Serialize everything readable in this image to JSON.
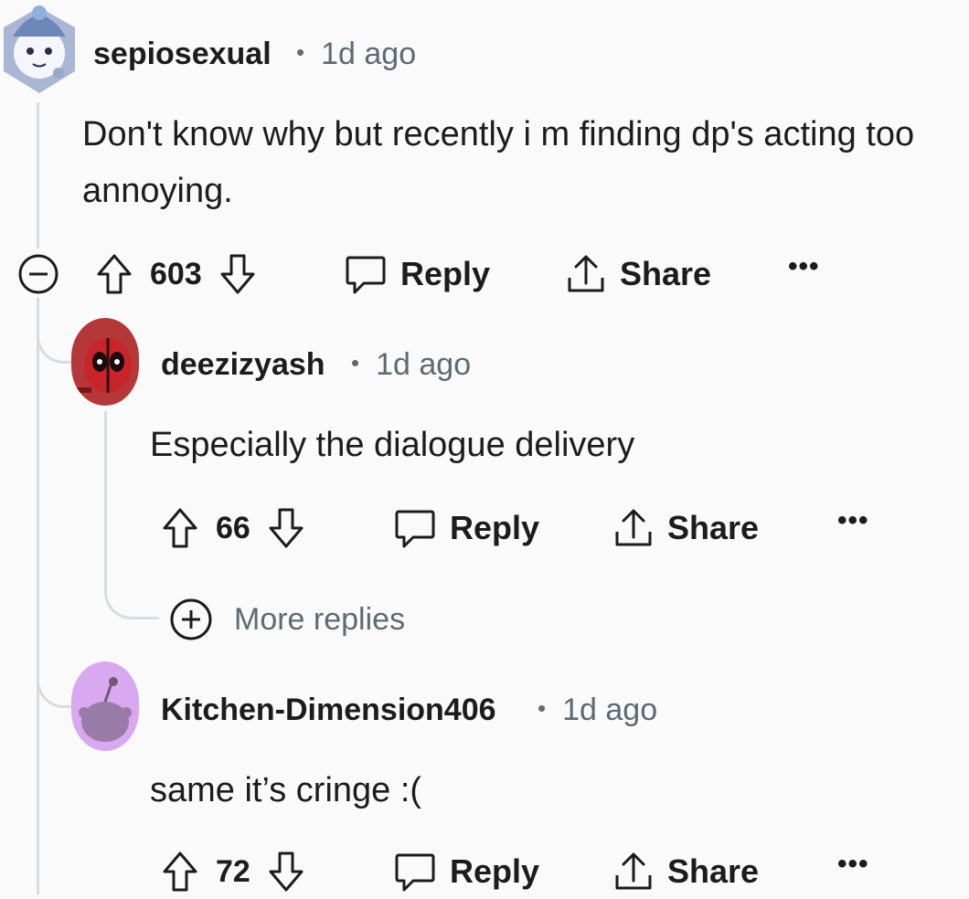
{
  "comments": [
    {
      "author": "sepiosexual",
      "time": "1d ago",
      "body": "Don't know why but recently i m finding dp's acting too annoying.",
      "score": "603",
      "reply_label": "Reply",
      "share_label": "Share",
      "more_label": "•••",
      "avatar_icon": "wizard-cat-avatar-icon"
    },
    {
      "author": "deezizyash",
      "time": "1d ago",
      "body": "Especially the dialogue delivery",
      "score": "66",
      "reply_label": "Reply",
      "share_label": "Share",
      "more_label": "•••",
      "avatar_icon": "deadpool-avatar-icon"
    },
    {
      "author": "Kitchen-Dimension406",
      "time": "1d ago",
      "body": "same it’s cringe :(",
      "score": "72",
      "reply_label": "Reply",
      "share_label": "Share",
      "more_label": "•••",
      "avatar_icon": "default-snoo-avatar-icon"
    }
  ],
  "more_replies_label": "More replies",
  "colors": {
    "text": "#1c1c1c",
    "meta": "#5c6b73",
    "thread_line": "#d9dcdf",
    "background": "#fafafa",
    "snoo_bg": "#d8a8f0"
  }
}
